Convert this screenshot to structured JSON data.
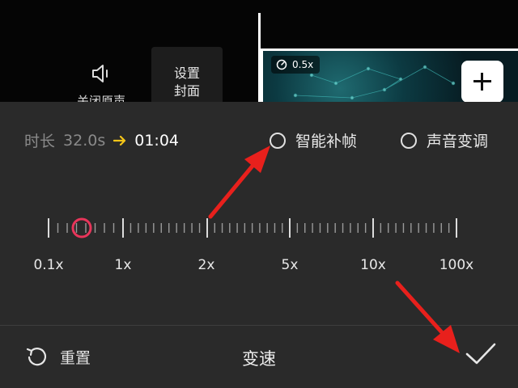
{
  "toolbar": {
    "mute_label": "关闭原声",
    "cover_label_line1": "设置",
    "cover_label_line2": "封面",
    "mute_icon": "speaker-icon",
    "add_icon": "plus-icon"
  },
  "clip": {
    "speed_badge": "0.5x",
    "speed_icon": "gauge-icon"
  },
  "speed_panel": {
    "duration_label": "时长",
    "duration_original": "32.0s",
    "duration_new": "01:04",
    "arrow_color": "#f5c518",
    "option_smooth": "智能补帧",
    "option_voice": "声音变调",
    "scale_labels": [
      "0.1x",
      "1x",
      "2x",
      "5x",
      "10x",
      "100x"
    ],
    "knob_color": "#e8355a",
    "selected_speed_label": "0.5x",
    "reset_label": "重置",
    "title": "变速",
    "reset_icon": "reset-icon",
    "confirm_icon": "checkmark-icon"
  },
  "annotations": {
    "arrow_color": "#e8201c"
  }
}
